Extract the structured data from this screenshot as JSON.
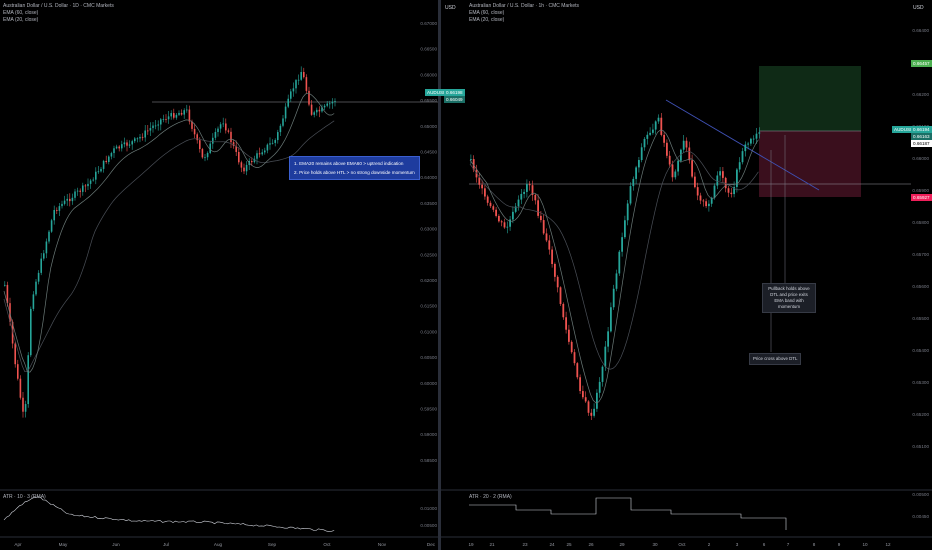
{
  "left_chart": {
    "title": "Australian Dollar / U.S. Dollar · 1D · CMC Markets",
    "ema60": "EMA (60, close)",
    "ema20": "EMA (20, close)",
    "currency": "USD",
    "price_ticks": [
      "0.67000",
      "0.66500",
      "0.66000",
      "0.65500",
      "0.65000",
      "0.64500",
      "0.64000",
      "0.63500",
      "0.63000",
      "0.62500",
      "0.62000",
      "0.61500",
      "0.61000",
      "0.60500",
      "0.60000",
      "0.59500",
      "0.59000",
      "0.58500"
    ],
    "last_price_label": "AUDUSD",
    "last_price": "0.66198",
    "last_price2": "0.66049",
    "time_labels": [
      "Apr",
      "May",
      "Jun",
      "Jul",
      "Aug",
      "Sep",
      "Oct",
      "Nov",
      "Dec"
    ],
    "atr_label": "ATR · 10 · 3 (RMA)",
    "atr_ticks": [
      "0.01000",
      "0.00500"
    ],
    "annotation_lines": [
      "1. EMA20 remains above EMA60 > uptrend indication",
      "2. Price holds above HTL > no strong downside momentum"
    ]
  },
  "right_chart": {
    "title": "Australian Dollar / U.S. Dollar · 1h · CMC Markets",
    "ema60": "EMA (60, close)",
    "ema20": "EMA (20, close)",
    "currency": "USD",
    "price_ticks": [
      "0.66400",
      "0.66300",
      "0.66200",
      "0.66100",
      "0.66000",
      "0.65900",
      "0.65800",
      "0.65700",
      "0.65600",
      "0.65500",
      "0.65400",
      "0.65300",
      "0.65200",
      "0.65100"
    ],
    "target_price": "0.66457",
    "last_price_label": "AUDUSD",
    "last_price": "0.66194",
    "last_price2": "0.66163",
    "entry_price": "0.66187",
    "stop_price": "0.65927",
    "time_labels": [
      "19",
      "21",
      "23",
      "24",
      "25",
      "26",
      "29",
      "30",
      "Oct",
      "2",
      "3",
      "6",
      "7",
      "8",
      "9",
      "10",
      "12"
    ],
    "tooltip1": "Pullback holds above DTL and price exits EMA band with momentum",
    "tooltip2": "Price cross above DTL",
    "atr_label": "ATR · 20 · 2 (RMA)",
    "atr_ticks": [
      "0.00500",
      "0.00450"
    ]
  },
  "colors": {
    "up": "#26a69a",
    "down": "#ef5350",
    "ema": "#5d6a6a",
    "target_zone": "#0f2a16",
    "stop_zone": "#3a0f1d",
    "annotation": "#1e3c9e"
  }
}
